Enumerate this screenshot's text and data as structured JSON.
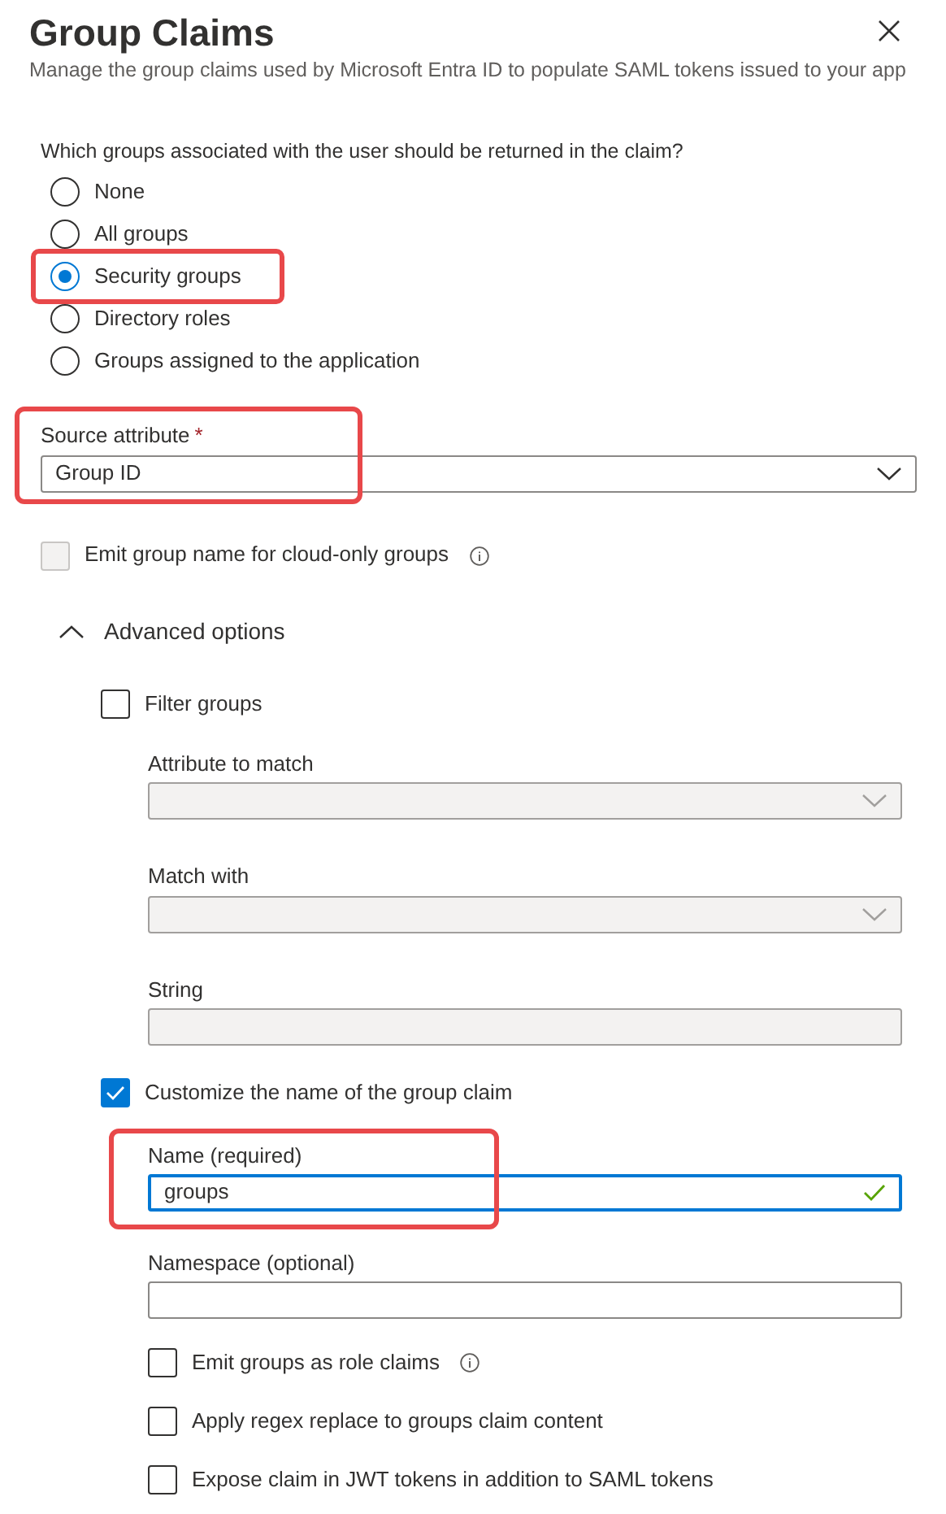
{
  "header": {
    "title": "Group Claims",
    "subtitle": "Manage the group claims used by Microsoft Entra ID to populate SAML tokens issued to your app"
  },
  "groups_question": "Which groups associated with the user should be returned in the claim?",
  "group_options": [
    {
      "label": "None",
      "selected": false,
      "highlighted": false
    },
    {
      "label": "All groups",
      "selected": false,
      "highlighted": false
    },
    {
      "label": "Security groups",
      "selected": true,
      "highlighted": true
    },
    {
      "label": "Directory roles",
      "selected": false,
      "highlighted": false
    },
    {
      "label": "Groups assigned to the application",
      "selected": false,
      "highlighted": false
    }
  ],
  "source_attribute": {
    "label": "Source attribute",
    "required_mark": "*",
    "value": "Group ID",
    "highlighted": true
  },
  "emit_cloud_only": {
    "label": "Emit group name for cloud-only groups",
    "checked": false,
    "disabled": true,
    "info": true
  },
  "advanced_options": {
    "label": "Advanced options",
    "expanded": true,
    "filter_groups": {
      "label": "Filter groups",
      "checked": false,
      "disabled": false,
      "info": false
    },
    "filter_fields": [
      {
        "kind": "select",
        "label": "Attribute to match",
        "disabled": true
      },
      {
        "kind": "select",
        "label": "Match with",
        "disabled": true
      },
      {
        "kind": "text",
        "label": "String",
        "disabled": true
      }
    ],
    "customize_name": {
      "label": "Customize the name of the group claim",
      "checked": true,
      "disabled": false,
      "info": false
    },
    "claim_fields": [
      {
        "kind": "text",
        "label": "Name (required)",
        "value": "groups",
        "disabled": false,
        "focused": true,
        "valid": true,
        "highlighted": true
      },
      {
        "kind": "text",
        "label": "Namespace (optional)",
        "disabled": false,
        "focused": false,
        "valid": false,
        "highlighted": false
      }
    ],
    "claim_options": [
      {
        "label": "Emit groups as role claims",
        "checked": false,
        "disabled": false,
        "info": true
      },
      {
        "label": "Apply regex replace to groups claim content",
        "checked": false,
        "disabled": false,
        "info": false
      },
      {
        "label": "Expose claim in JWT tokens in addition to SAML tokens",
        "checked": false,
        "disabled": false,
        "info": false
      }
    ]
  }
}
